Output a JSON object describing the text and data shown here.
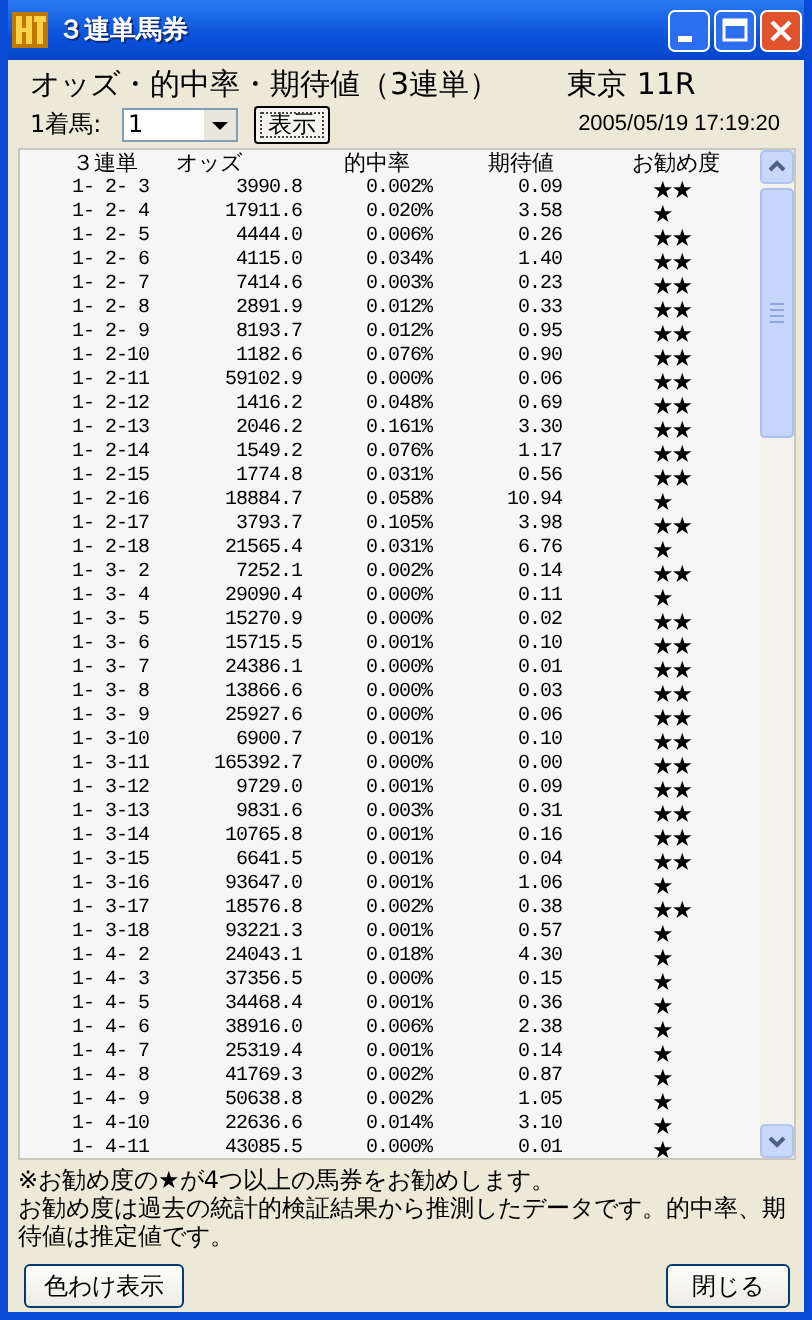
{
  "window": {
    "title": "３連単馬券"
  },
  "heading": {
    "title": "オッズ・的中率・期待値（3連単）",
    "venue": "東京 11R"
  },
  "controls": {
    "label": "1着馬:",
    "select": {
      "value": "1"
    },
    "button": "表示",
    "timestamp": "2005/05/19 17:19:20"
  },
  "table": {
    "columns": [
      "３連単",
      "オッズ",
      "的中率",
      "期待値",
      "お勧め度"
    ],
    "rows": [
      {
        "bet": "1- 2- 3",
        "odds": "3990.8",
        "hit_rate": "0.002%",
        "expected": "0.09",
        "rating": "★★"
      },
      {
        "bet": "1- 2- 4",
        "odds": "17911.6",
        "hit_rate": "0.020%",
        "expected": "3.58",
        "rating": "★"
      },
      {
        "bet": "1- 2- 5",
        "odds": "4444.0",
        "hit_rate": "0.006%",
        "expected": "0.26",
        "rating": "★★"
      },
      {
        "bet": "1- 2- 6",
        "odds": "4115.0",
        "hit_rate": "0.034%",
        "expected": "1.40",
        "rating": "★★"
      },
      {
        "bet": "1- 2- 7",
        "odds": "7414.6",
        "hit_rate": "0.003%",
        "expected": "0.23",
        "rating": "★★"
      },
      {
        "bet": "1- 2- 8",
        "odds": "2891.9",
        "hit_rate": "0.012%",
        "expected": "0.33",
        "rating": "★★"
      },
      {
        "bet": "1- 2- 9",
        "odds": "8193.7",
        "hit_rate": "0.012%",
        "expected": "0.95",
        "rating": "★★"
      },
      {
        "bet": "1- 2-10",
        "odds": "1182.6",
        "hit_rate": "0.076%",
        "expected": "0.90",
        "rating": "★★"
      },
      {
        "bet": "1- 2-11",
        "odds": "59102.9",
        "hit_rate": "0.000%",
        "expected": "0.06",
        "rating": "★★"
      },
      {
        "bet": "1- 2-12",
        "odds": "1416.2",
        "hit_rate": "0.048%",
        "expected": "0.69",
        "rating": "★★"
      },
      {
        "bet": "1- 2-13",
        "odds": "2046.2",
        "hit_rate": "0.161%",
        "expected": "3.30",
        "rating": "★★"
      },
      {
        "bet": "1- 2-14",
        "odds": "1549.2",
        "hit_rate": "0.076%",
        "expected": "1.17",
        "rating": "★★"
      },
      {
        "bet": "1- 2-15",
        "odds": "1774.8",
        "hit_rate": "0.031%",
        "expected": "0.56",
        "rating": "★★"
      },
      {
        "bet": "1- 2-16",
        "odds": "18884.7",
        "hit_rate": "0.058%",
        "expected": "10.94",
        "rating": "★"
      },
      {
        "bet": "1- 2-17",
        "odds": "3793.7",
        "hit_rate": "0.105%",
        "expected": "3.98",
        "rating": "★★"
      },
      {
        "bet": "1- 2-18",
        "odds": "21565.4",
        "hit_rate": "0.031%",
        "expected": "6.76",
        "rating": "★"
      },
      {
        "bet": "1- 3- 2",
        "odds": "7252.1",
        "hit_rate": "0.002%",
        "expected": "0.14",
        "rating": "★★"
      },
      {
        "bet": "1- 3- 4",
        "odds": "29090.4",
        "hit_rate": "0.000%",
        "expected": "0.11",
        "rating": "★"
      },
      {
        "bet": "1- 3- 5",
        "odds": "15270.9",
        "hit_rate": "0.000%",
        "expected": "0.02",
        "rating": "★★"
      },
      {
        "bet": "1- 3- 6",
        "odds": "15715.5",
        "hit_rate": "0.001%",
        "expected": "0.10",
        "rating": "★★"
      },
      {
        "bet": "1- 3- 7",
        "odds": "24386.1",
        "hit_rate": "0.000%",
        "expected": "0.01",
        "rating": "★★"
      },
      {
        "bet": "1- 3- 8",
        "odds": "13866.6",
        "hit_rate": "0.000%",
        "expected": "0.03",
        "rating": "★★"
      },
      {
        "bet": "1- 3- 9",
        "odds": "25927.6",
        "hit_rate": "0.000%",
        "expected": "0.06",
        "rating": "★★"
      },
      {
        "bet": "1- 3-10",
        "odds": "6900.7",
        "hit_rate": "0.001%",
        "expected": "0.10",
        "rating": "★★"
      },
      {
        "bet": "1- 3-11",
        "odds": "165392.7",
        "hit_rate": "0.000%",
        "expected": "0.00",
        "rating": "★★"
      },
      {
        "bet": "1- 3-12",
        "odds": "9729.0",
        "hit_rate": "0.001%",
        "expected": "0.09",
        "rating": "★★"
      },
      {
        "bet": "1- 3-13",
        "odds": "9831.6",
        "hit_rate": "0.003%",
        "expected": "0.31",
        "rating": "★★"
      },
      {
        "bet": "1- 3-14",
        "odds": "10765.8",
        "hit_rate": "0.001%",
        "expected": "0.16",
        "rating": "★★"
      },
      {
        "bet": "1- 3-15",
        "odds": "6641.5",
        "hit_rate": "0.001%",
        "expected": "0.04",
        "rating": "★★"
      },
      {
        "bet": "1- 3-16",
        "odds": "93647.0",
        "hit_rate": "0.001%",
        "expected": "1.06",
        "rating": "★"
      },
      {
        "bet": "1- 3-17",
        "odds": "18576.8",
        "hit_rate": "0.002%",
        "expected": "0.38",
        "rating": "★★"
      },
      {
        "bet": "1- 3-18",
        "odds": "93221.3",
        "hit_rate": "0.001%",
        "expected": "0.57",
        "rating": "★"
      },
      {
        "bet": "1- 4- 2",
        "odds": "24043.1",
        "hit_rate": "0.018%",
        "expected": "4.30",
        "rating": "★"
      },
      {
        "bet": "1- 4- 3",
        "odds": "37356.5",
        "hit_rate": "0.000%",
        "expected": "0.15",
        "rating": "★"
      },
      {
        "bet": "1- 4- 5",
        "odds": "34468.4",
        "hit_rate": "0.001%",
        "expected": "0.36",
        "rating": "★"
      },
      {
        "bet": "1- 4- 6",
        "odds": "38916.0",
        "hit_rate": "0.006%",
        "expected": "2.38",
        "rating": "★"
      },
      {
        "bet": "1- 4- 7",
        "odds": "25319.4",
        "hit_rate": "0.001%",
        "expected": "0.14",
        "rating": "★"
      },
      {
        "bet": "1- 4- 8",
        "odds": "41769.3",
        "hit_rate": "0.002%",
        "expected": "0.87",
        "rating": "★"
      },
      {
        "bet": "1- 4- 9",
        "odds": "50638.8",
        "hit_rate": "0.002%",
        "expected": "1.05",
        "rating": "★"
      },
      {
        "bet": "1- 4-10",
        "odds": "22636.6",
        "hit_rate": "0.014%",
        "expected": "3.10",
        "rating": "★"
      },
      {
        "bet": "1- 4-11",
        "odds": "43085.5",
        "hit_rate": "0.000%",
        "expected": "0.01",
        "rating": "★"
      }
    ]
  },
  "notes": [
    "※お勧め度の★が4つ以上の馬券をお勧めします。",
    "お勧め度は過去の統計的検証結果から推測したデータです。的中率、期待値は推定値です。"
  ],
  "buttons": [
    "色わけ表示",
    "閉じる"
  ]
}
